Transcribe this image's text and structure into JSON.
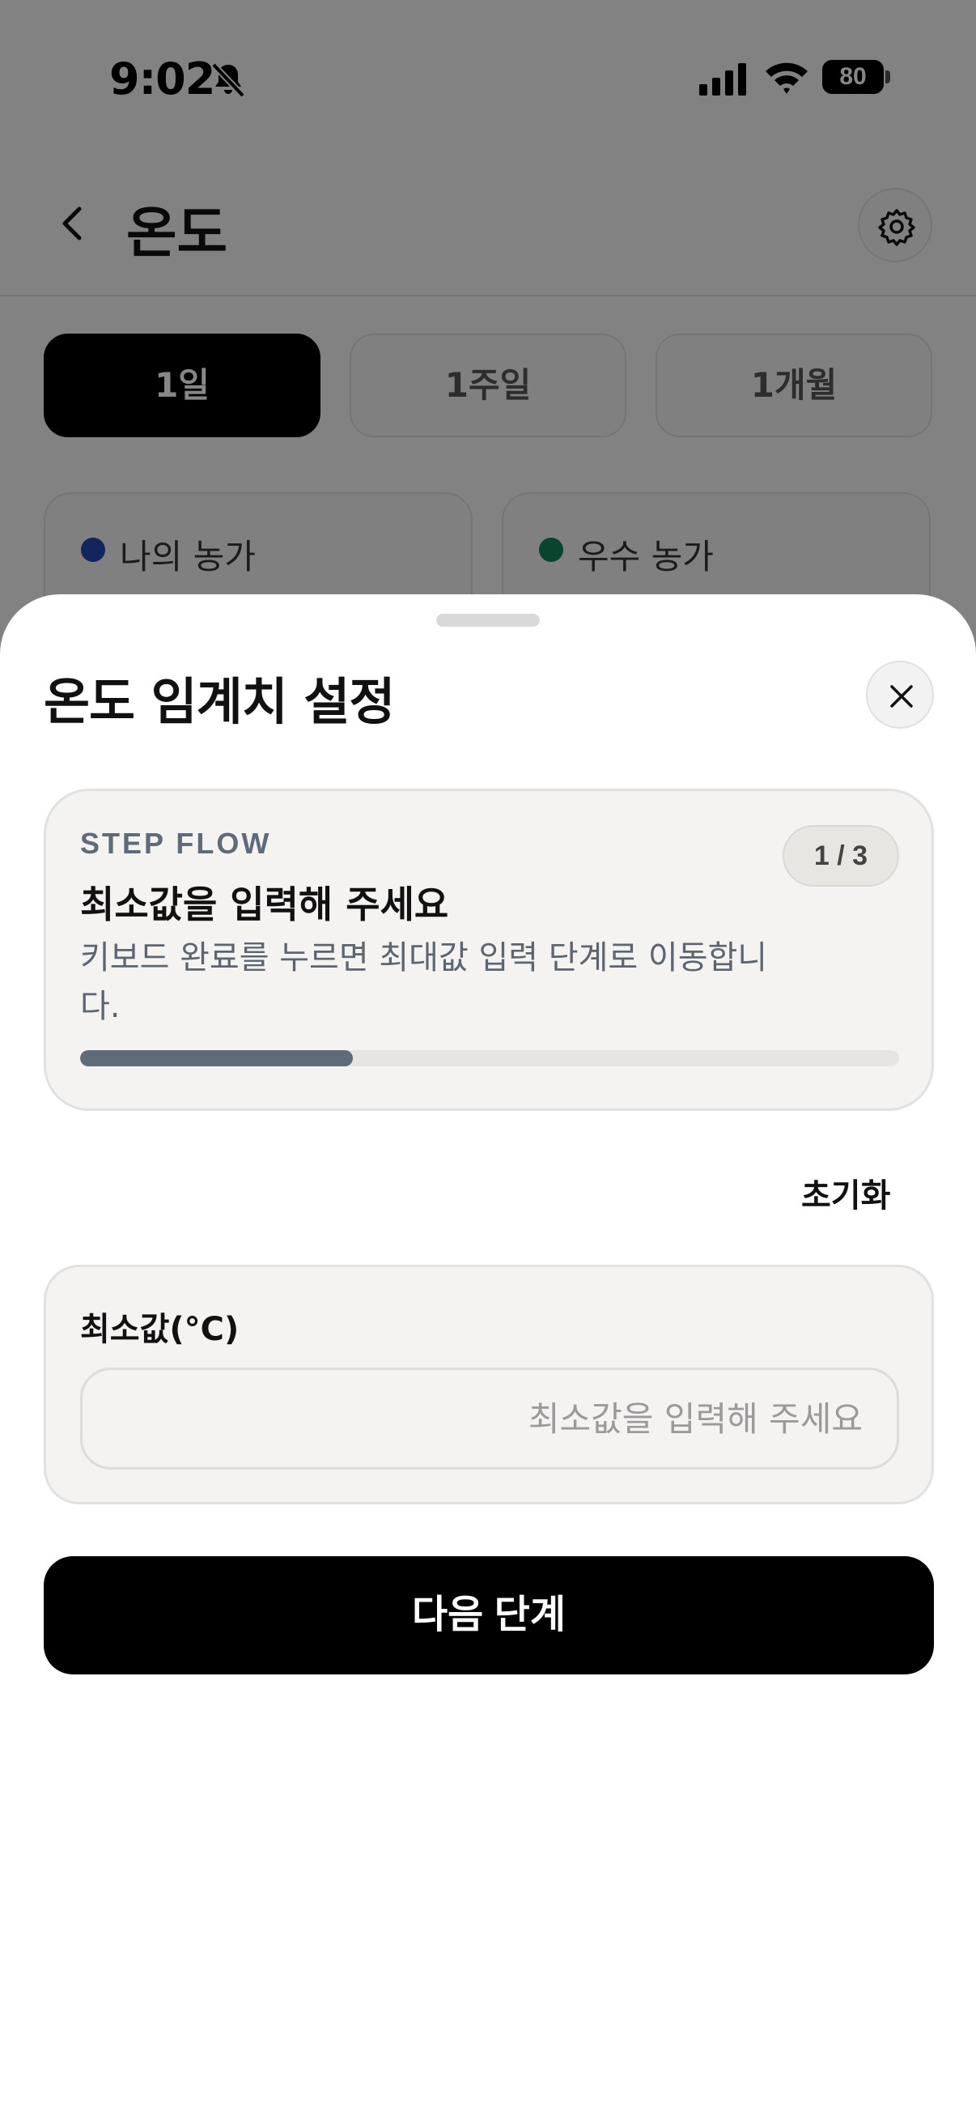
{
  "status_bar": {
    "time": "9:02",
    "battery_level": "80",
    "icons": [
      "bell-slash-icon",
      "cellular-signal-icon",
      "wifi-icon",
      "battery-icon"
    ]
  },
  "header": {
    "title": "온도",
    "back_icon": "chevron-left-icon",
    "settings_icon": "gear-icon"
  },
  "period_tabs": [
    {
      "label": "1일",
      "active": true
    },
    {
      "label": "1주일",
      "active": false
    },
    {
      "label": "1개월",
      "active": false
    }
  ],
  "compare_cards": [
    {
      "label": "나의 농가",
      "dot_color": "#2249b0"
    },
    {
      "label": "우수 농가",
      "dot_color": "#12805a"
    }
  ],
  "sheet": {
    "title": "온도 임계치 설정",
    "close_icon": "close-icon",
    "step": {
      "eyebrow": "STEP FLOW",
      "count": "1 / 3",
      "title": "최소값을 입력해 주세요",
      "description": "키보드 완료를 누르면 최대값 입력 단계로 이동합니다.",
      "progress": 0.3333
    },
    "reset_label": "초기화",
    "input": {
      "label": "최소값(°C)",
      "value": "",
      "placeholder": "최소값을 입력해 주세요"
    },
    "next_label": "다음 단계"
  },
  "colors": {
    "accent": "#000000",
    "progress": "#5e6b79",
    "card_bg": "#f4f3f1",
    "scrim": "rgba(0,0,0,0.47)"
  }
}
